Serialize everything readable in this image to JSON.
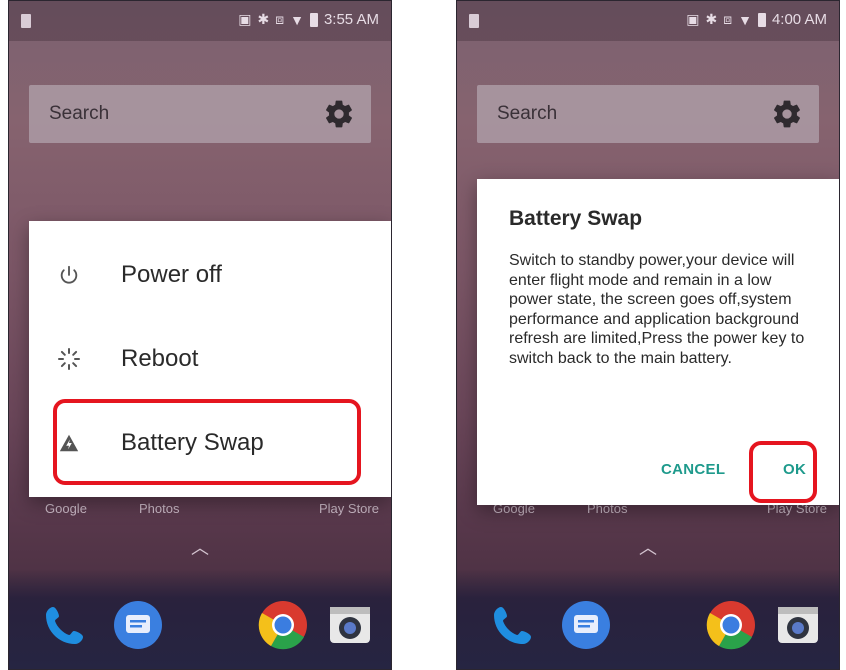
{
  "left_screen": {
    "status_time": "3:55 AM",
    "search_placeholder": "Search",
    "power_menu": {
      "items": [
        {
          "label": "Power off",
          "icon": "power-icon"
        },
        {
          "label": "Reboot",
          "icon": "reboot-icon"
        },
        {
          "label": "Battery Swap",
          "icon": "battery-swap-icon"
        }
      ]
    },
    "app_labels": [
      "Google",
      "Photos",
      "Play Store"
    ]
  },
  "right_screen": {
    "status_time": "4:00 AM",
    "search_placeholder": "Search",
    "dialog": {
      "title": "Battery Swap",
      "message": "Switch to standby power,your device will enter flight mode and remain in a low power state, the screen goes off,system performance and application background refresh are limited,Press the power key to switch back to the main battery.",
      "cancel_label": "CANCEL",
      "ok_label": "OK"
    },
    "app_labels": [
      "Google",
      "Photos",
      "Play Store"
    ]
  },
  "colors": {
    "highlight": "#e5151f",
    "dialog_button": "#1e9a8c",
    "wallpaper_top": "#7b6270",
    "wallpaper_bottom": "#402a3b"
  }
}
